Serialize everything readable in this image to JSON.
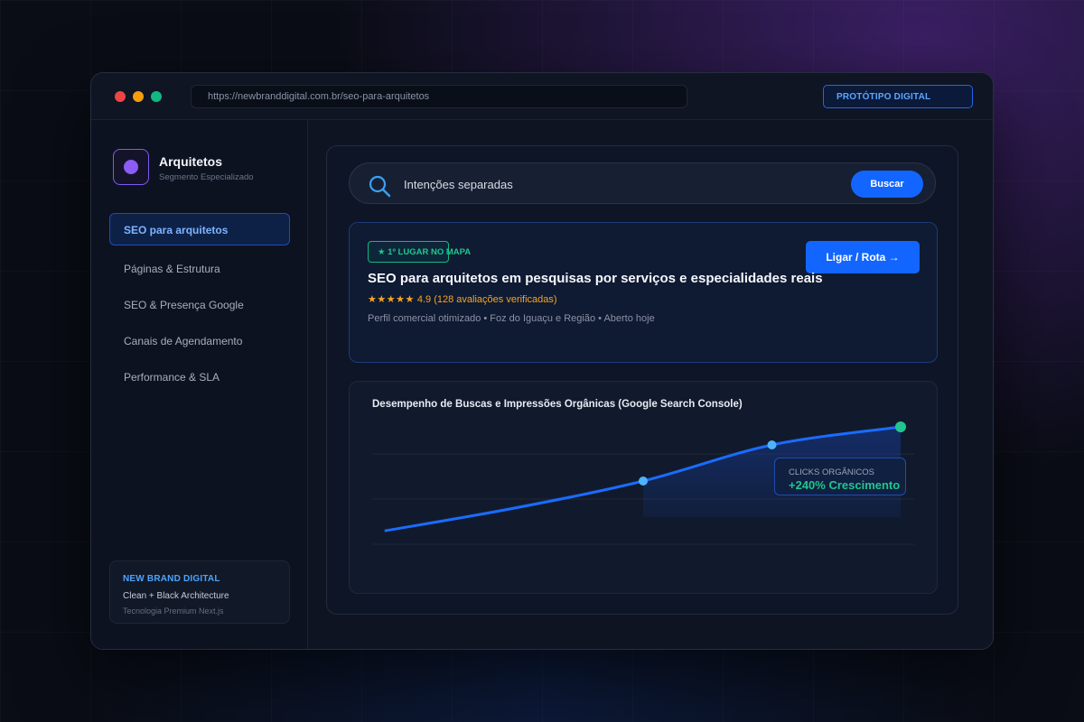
{
  "browser": {
    "url": "https://newbranddigital.com.br/seo-para-arquitetos",
    "badge": "PROTÓTIPO DIGITAL"
  },
  "sidebar": {
    "brand_title": "Arquitetos",
    "brand_subtitle": "Segmento Especializado",
    "items": [
      {
        "label": "SEO para arquitetos",
        "active": true
      },
      {
        "label": "Páginas & Estrutura",
        "active": false
      },
      {
        "label": "SEO & Presença Google",
        "active": false
      },
      {
        "label": "Canais de Agendamento",
        "active": false
      },
      {
        "label": "Performance & SLA",
        "active": false
      }
    ],
    "card": {
      "title": "NEW BRAND DIGITAL",
      "line1": "Clean + Black Architecture",
      "line2": "Tecnologia Premium Next.js"
    }
  },
  "search": {
    "query": "Intenções separadas",
    "button": "Buscar"
  },
  "result": {
    "badge": "★ 1º LUGAR NO MAPA",
    "cta": "Ligar / Rota →",
    "title": "SEO para arquitetos em pesquisas por serviços e especialidades reais",
    "stars": "★★★★★",
    "rating": "4.9 (128 avaliações verificadas)",
    "meta": "Perfil comercial otimizado • Foz do Iguaçu e Região • Aberto hoje"
  },
  "chart": {
    "title": "Desempenho de Buscas e Impressões Orgânicas (Google Search Console)",
    "stat_label": "CLICKS ORGÂNICOS",
    "stat_value": "+240% Crescimento"
  },
  "colors": {
    "accent": "#1266ff",
    "success": "#21c58f",
    "line": "#1a6cff",
    "point": "#4db3ff"
  },
  "chart_data": {
    "type": "line",
    "title": "Desempenho de Buscas e Impressões Orgânicas (Google Search Console)",
    "xlabel": "",
    "ylabel": "",
    "x": [
      0,
      1,
      2,
      3,
      4
    ],
    "series": [
      {
        "values": [
          0.05,
          0.3,
          0.6,
          1.0,
          1.2
        ]
      }
    ],
    "markers": [
      {
        "x": 2,
        "y": 0.6
      },
      {
        "x": 3,
        "y": 1.0
      },
      {
        "x": 4,
        "y": 1.2
      }
    ],
    "ylim": [
      0,
      1.2
    ],
    "xlim": [
      0,
      4
    ],
    "grid": true
  }
}
